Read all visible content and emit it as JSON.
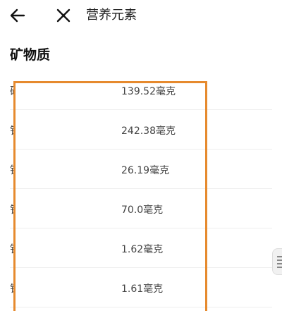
{
  "header": {
    "title": "营养元素",
    "back_icon": "arrow-left-icon",
    "close_icon": "close-icon"
  },
  "section": {
    "title": "矿物质"
  },
  "minerals": [
    {
      "name": "磷",
      "value": "139.52毫克"
    },
    {
      "name": "钾",
      "value": "242.38毫克"
    },
    {
      "name": "镁",
      "value": "26.19毫克"
    },
    {
      "name": "钙",
      "value": "70.0毫克"
    },
    {
      "name": "铁",
      "value": "1.62毫克"
    },
    {
      "name": "锌",
      "value": "1.61毫克"
    }
  ],
  "colors": {
    "highlight": "#e68a2e",
    "divider": "#eeeeee"
  }
}
